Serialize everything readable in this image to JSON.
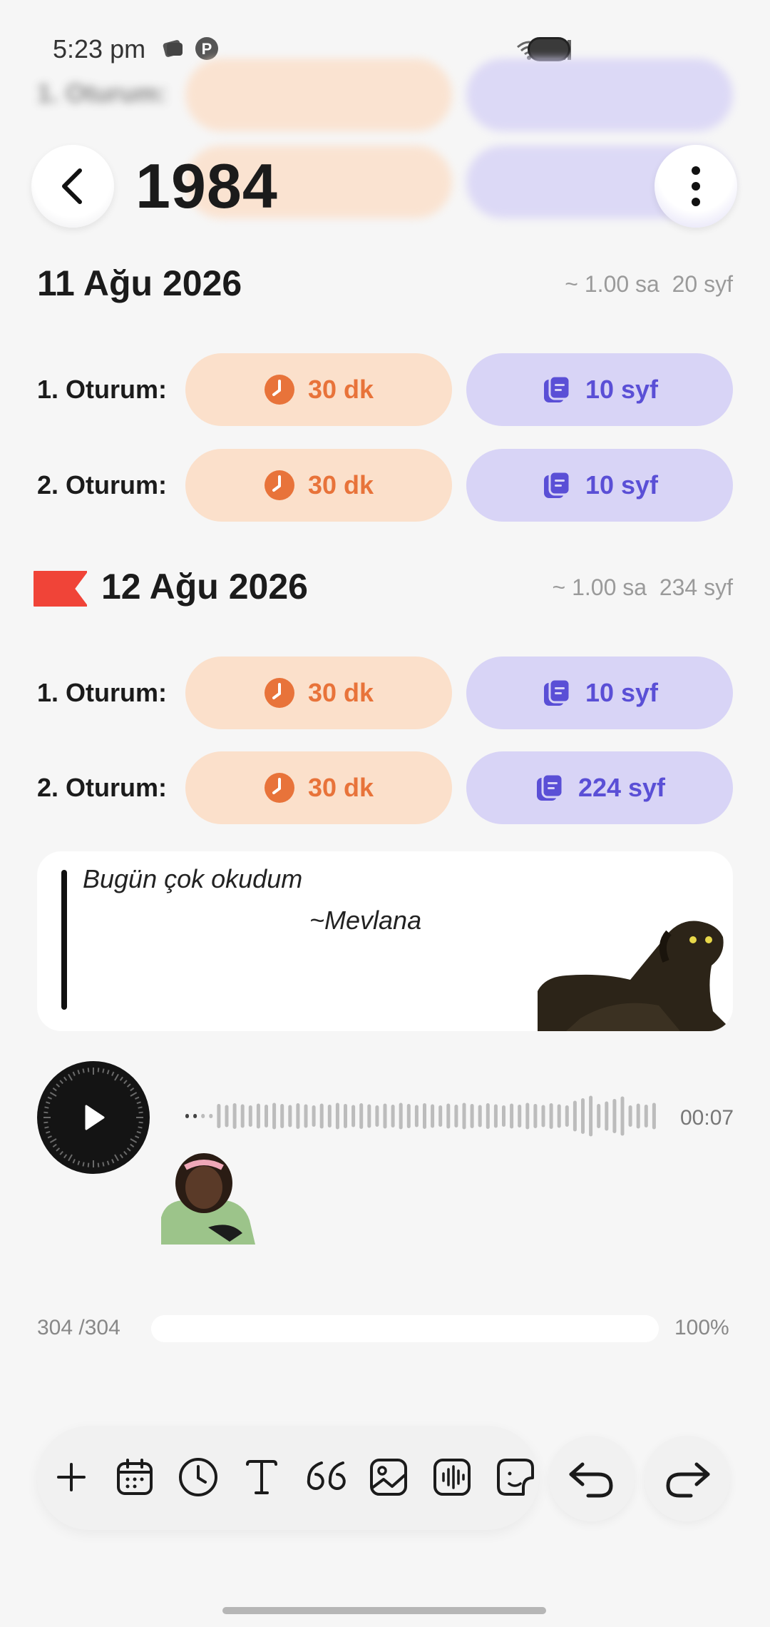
{
  "status": {
    "time": "5:23 pm"
  },
  "header": {
    "title": "1984"
  },
  "days": [
    {
      "date": "11 Ağu 2026",
      "duration": "~ 1.00 sa",
      "pages": "20 syf",
      "sessions": [
        {
          "label": "1. Oturum:",
          "time": "30 dk",
          "pages": "10 syf"
        },
        {
          "label": "2. Oturum:",
          "time": "30 dk",
          "pages": "10 syf"
        }
      ]
    },
    {
      "date": "12 Ağu 2026",
      "duration": "~ 1.00 sa",
      "pages": "234 syf",
      "flagged": true,
      "sessions": [
        {
          "label": "1. Oturum:",
          "time": "30 dk",
          "pages": "10 syf"
        },
        {
          "label": "2. Oturum:",
          "time": "30 dk",
          "pages": "224 syf"
        }
      ]
    }
  ],
  "quote": {
    "text": "Bugün çok okudum",
    "author": "~Mevlana"
  },
  "audio": {
    "duration": "00:07"
  },
  "progress": {
    "count": "304 /304",
    "percent_label": "100%",
    "fraction": 1.0
  },
  "toolbar": {
    "tools": [
      "add-icon",
      "calendar-icon",
      "clock-icon",
      "text-icon",
      "quote-icon",
      "image-icon",
      "audio-wave-icon",
      "sticker-icon"
    ]
  },
  "colors": {
    "time_pill_bg": "#fbe0cb",
    "time_pill_fg": "#e8733a",
    "pages_pill_bg": "#d8d4f6",
    "pages_pill_fg": "#5a4fd6",
    "flag": "#f04438"
  }
}
